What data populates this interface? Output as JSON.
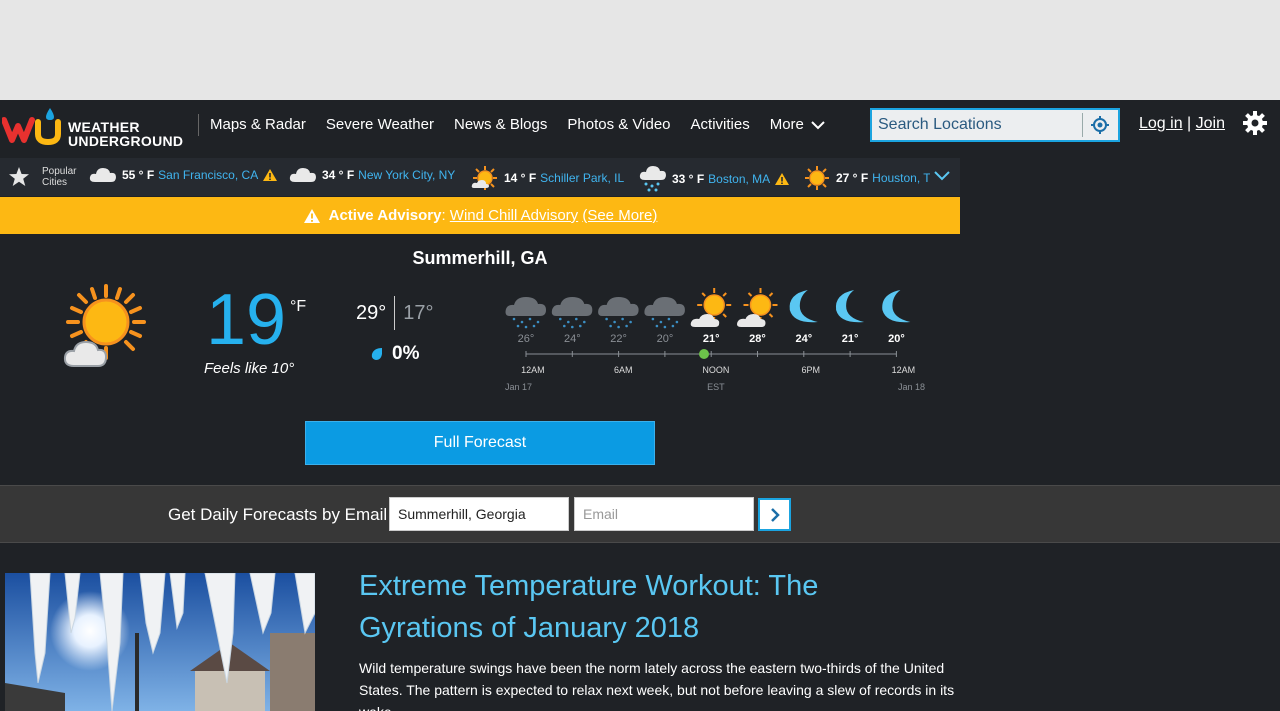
{
  "brand": {
    "line1": "WEATHER",
    "line2": "UNDERGROUND",
    "accent_red": "#e8312f",
    "accent_yellow": "#fdb813",
    "accent_blue": "#1ba4e0"
  },
  "nav": {
    "items": [
      "Maps & Radar",
      "Severe Weather",
      "News & Blogs",
      "Photos & Video",
      "Activities"
    ],
    "more_label": "More"
  },
  "search": {
    "placeholder": "Search Locations"
  },
  "auth": {
    "login": "Log in",
    "sep": "|",
    "join": "Join"
  },
  "cities_bar": {
    "label_line1": "Popular",
    "label_line2": "Cities",
    "cities": [
      {
        "icon": "cloudy-icon",
        "temp": "55 ° F",
        "name": "San Francisco, CA",
        "alert": true
      },
      {
        "icon": "cloudy-icon",
        "temp": "34 ° F",
        "name": "New York City, NY",
        "alert": false
      },
      {
        "icon": "partly-sunny-icon",
        "temp": "14 ° F",
        "name": "Schiller Park, IL",
        "alert": false
      },
      {
        "icon": "snow-icon",
        "temp": "33 ° F",
        "name": "Boston, MA",
        "alert": true
      },
      {
        "icon": "sunny-icon",
        "temp": "27 ° F",
        "name": "Houston, T",
        "alert": false
      }
    ]
  },
  "advisory": {
    "label": "Active Advisory",
    "colon": ":",
    "link": "Wind Chill Advisory",
    "see_more": "(See More)"
  },
  "current": {
    "location": "Summerhill, GA",
    "icon": "partly-cloudy-icon",
    "temp": "19",
    "unit": "°F",
    "feels_like": "Feels like 10°",
    "high": "29°",
    "low": "17°",
    "precip": "0%"
  },
  "hourly": {
    "icons": [
      "snow-icon",
      "snow-icon",
      "snow-icon",
      "snow-icon",
      "partly-sunny-icon",
      "partly-sunny-icon",
      "moon-icon",
      "moon-icon",
      "moon-icon"
    ],
    "temps": [
      "26°",
      "24°",
      "22°",
      "20°",
      "21°",
      "28°",
      "24°",
      "21°",
      "20°"
    ],
    "past_count": 4,
    "times": [
      "12AM",
      "6AM",
      "NOON",
      "6PM",
      "12AM"
    ],
    "tz": "EST",
    "start_date": "Jan 17",
    "end_date": "Jan 18"
  },
  "full_forecast_label": "Full Forecast",
  "email": {
    "label": "Get Daily Forecasts by Email",
    "location_value": "Summerhill, Georgia",
    "email_placeholder": "Email"
  },
  "article": {
    "title": "Extreme Temperature Workout: The Gyrations of January 2018",
    "body": "Wild temperature swings have been the norm lately across the eastern two-thirds of the United States. The pattern is expected to relax next week, but not before leaving a slew of records in its wake."
  }
}
